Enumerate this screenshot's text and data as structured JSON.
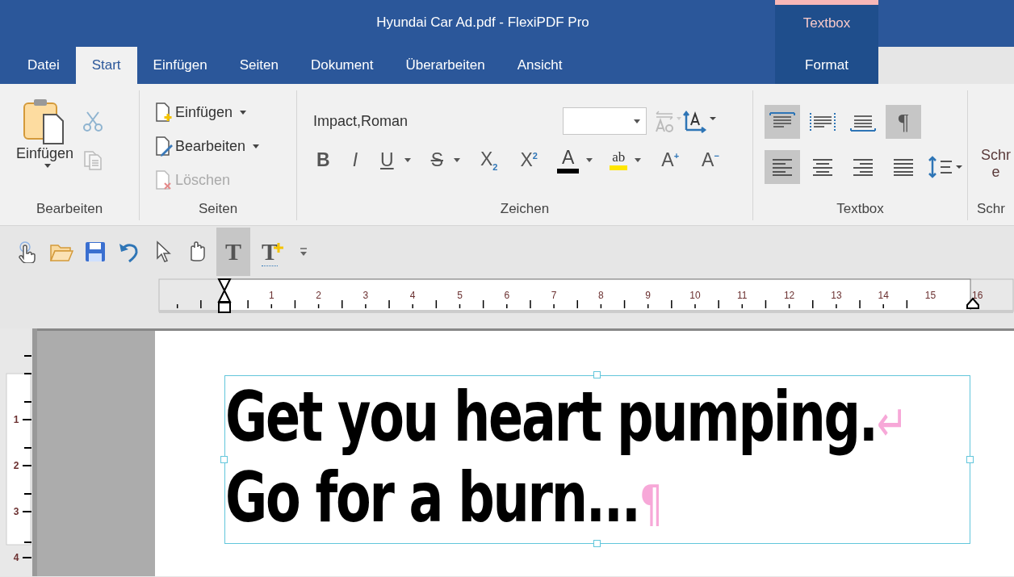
{
  "window": {
    "title": "Hyundai Car Ad.pdf - FlexiPDF Pro",
    "context_label": "Textbox"
  },
  "tabs": [
    {
      "label": "Datei",
      "selected": false,
      "kind": "normal"
    },
    {
      "label": "Start",
      "selected": true,
      "kind": "normal"
    },
    {
      "label": "Einfügen",
      "selected": false,
      "kind": "normal"
    },
    {
      "label": "Seiten",
      "selected": false,
      "kind": "normal"
    },
    {
      "label": "Dokument",
      "selected": false,
      "kind": "normal"
    },
    {
      "label": "Überarbeiten",
      "selected": false,
      "kind": "normal"
    },
    {
      "label": "Ansicht",
      "selected": false,
      "kind": "normal"
    },
    {
      "label": "Format",
      "selected": false,
      "kind": "contextual"
    }
  ],
  "clipboard": {
    "paste_label": "Einfügen",
    "group_label": "Bearbeiten"
  },
  "pages": {
    "group_label": "Seiten",
    "items": [
      {
        "label": "Einfügen",
        "kind": "insert",
        "disabled": false,
        "dropdown": true
      },
      {
        "label": "Bearbeiten",
        "kind": "edit",
        "disabled": false,
        "dropdown": true
      },
      {
        "label": "Löschen",
        "kind": "delete",
        "disabled": true,
        "dropdown": false
      }
    ]
  },
  "font": {
    "group_label": "Zeichen",
    "font_name": "Impact,Roman",
    "format_buttons": [
      {
        "glyph": "B",
        "kind": "bold",
        "dropdown": false
      },
      {
        "glyph": "I",
        "kind": "italic",
        "dropdown": false
      },
      {
        "glyph": "U",
        "kind": "underline",
        "dropdown": true
      },
      {
        "glyph": "S",
        "kind": "strike",
        "dropdown": true
      },
      {
        "glyph": "X$_{2}$",
        "kind": "script",
        "dropdown": false
      },
      {
        "glyph": "X$^{2}$",
        "kind": "script",
        "dropdown": false
      },
      {
        "glyph": "A",
        "kind": "color",
        "dropdown": true
      },
      {
        "glyph": "ab",
        "kind": "highlight",
        "dropdown": true
      },
      {
        "glyph": "A$^{+}$",
        "kind": "script",
        "dropdown": false
      },
      {
        "glyph": "A$^{−}$",
        "kind": "script",
        "dropdown": false
      }
    ]
  },
  "textbox_group": {
    "group_label": "Textbox",
    "mark_glyph": "¶",
    "marks_on": true,
    "layout_buttons": [
      {
        "kind": "top",
        "on": true
      },
      {
        "kind": "middle",
        "on": false
      },
      {
        "kind": "bottom",
        "on": false
      }
    ],
    "align": [
      {
        "kind": "left",
        "selected": true
      },
      {
        "kind": "center",
        "selected": false
      },
      {
        "kind": "right",
        "selected": false
      },
      {
        "kind": "justify",
        "selected": false
      }
    ]
  },
  "cut_group": {
    "button_lines": [
      "Schr",
      "e"
    ],
    "group_label": "Schr"
  },
  "toolbar": [
    {
      "kind": "touch",
      "on": false
    },
    {
      "kind": "open",
      "on": false
    },
    {
      "kind": "save",
      "on": false
    },
    {
      "kind": "undo",
      "on": false
    },
    {
      "kind": "pointer",
      "on": false
    },
    {
      "kind": "hand",
      "on": false
    },
    {
      "kind": "text",
      "glyph": "T",
      "on": true
    },
    {
      "kind": "add-text",
      "glyph": "T",
      "on": false
    },
    {
      "kind": "more",
      "on": false
    }
  ],
  "ruler": {
    "numbers": [
      "1",
      "2",
      "3",
      "4",
      "5",
      "6",
      "7",
      "8",
      "9",
      "10",
      "11",
      "12",
      "13",
      "14",
      "15",
      "16"
    ]
  },
  "vertical_ruler": {
    "numbers": [
      "1",
      "2",
      "3",
      "4"
    ]
  },
  "textbox": {
    "lines": [
      {
        "text": "Get you heart pumping.",
        "end_mark": "↵"
      },
      {
        "text": "Go for a burn...",
        "end_mark": "¶"
      }
    ]
  }
}
